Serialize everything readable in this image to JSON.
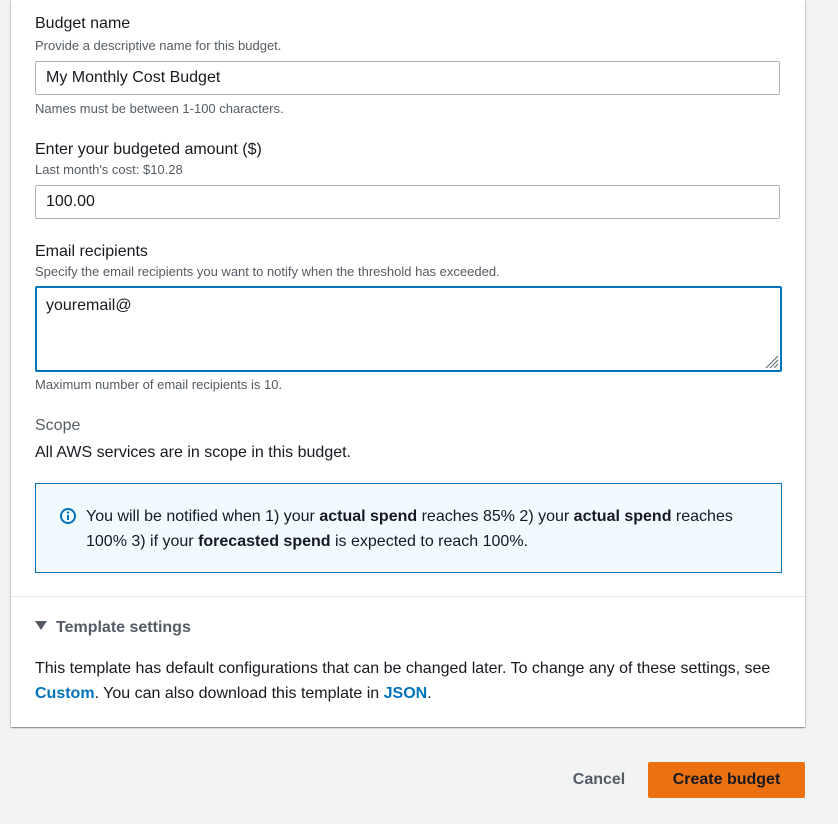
{
  "budget_name": {
    "label": "Budget name",
    "description": "Provide a descriptive name for this budget.",
    "value": "My Monthly Cost Budget",
    "constraint": "Names must be between 1-100 characters."
  },
  "budget_amount": {
    "label": "Enter your budgeted amount ($)",
    "description": "Last month's cost: $10.28",
    "value": "100.00"
  },
  "email_recipients": {
    "label": "Email recipients",
    "description": "Specify the email recipients you want to notify when the threshold has exceeded.",
    "value": "youremail@",
    "constraint": "Maximum number of email recipients is 10."
  },
  "scope": {
    "label": "Scope",
    "text": "All AWS services are in scope in this budget."
  },
  "info": {
    "part1": "You will be notified when 1) your ",
    "bold1": "actual spend",
    "part2": " reaches 85% 2) your ",
    "bold2": "actual spend",
    "part3": " reaches 100% 3) if your ",
    "bold3": "forecasted spend",
    "part4": " is expected to reach 100%.",
    "icon": "info-icon"
  },
  "template_settings": {
    "label": "Template settings",
    "text_before": "This template has default configurations that can be changed later. To change any of these settings, see ",
    "link_custom": "Custom",
    "text_middle": ". You can also download this template in ",
    "link_json": "JSON",
    "text_after": "."
  },
  "actions": {
    "cancel_label": "Cancel",
    "create_label": "Create budget"
  },
  "colors": {
    "accent": "#0073bb",
    "primary_button": "#ec7211",
    "info_background": "#f1faff"
  }
}
